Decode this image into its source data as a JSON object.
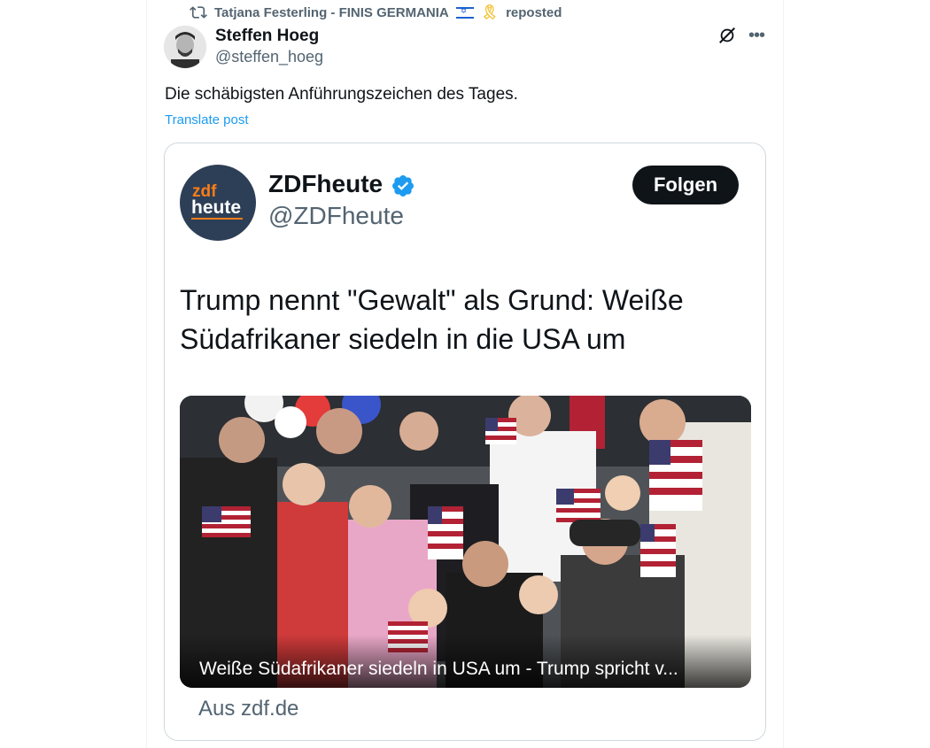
{
  "repost": {
    "reposter": "Tatjana Festerling - FINIS GERMANIA",
    "action": "reposted"
  },
  "author": {
    "name": "Steffen Hoeg",
    "handle": "@steffen_hoeg"
  },
  "post": {
    "text": "Die schäbigsten Anführungszeichen des Tages.",
    "translate": "Translate post"
  },
  "embed": {
    "logo_top": "zdf",
    "logo_bottom": "heute",
    "name": "ZDFheute",
    "handle": "@ZDFheute",
    "follow_label": "Folgen",
    "headline": "Trump nennt \"Gewalt\" als Grund: Weiße Südafrikaner siedeln in die USA um",
    "image_caption": "Weiße Südafrikaner siedeln in USA um - Trump spricht v...",
    "source": "Aus zdf.de"
  },
  "icons": {
    "repost": "repost-icon",
    "flag": "israel-flag-icon",
    "ribbon": "yellow-ribbon-icon",
    "grok": "grok-icon",
    "more": "more-icon",
    "verified": "verified-badge-icon"
  },
  "colors": {
    "accent_link": "#1d9bf0",
    "text_primary": "#0f1419",
    "text_secondary": "#536471",
    "zdf_orange": "#fa7d19",
    "zdf_navy": "#2d3f56"
  }
}
